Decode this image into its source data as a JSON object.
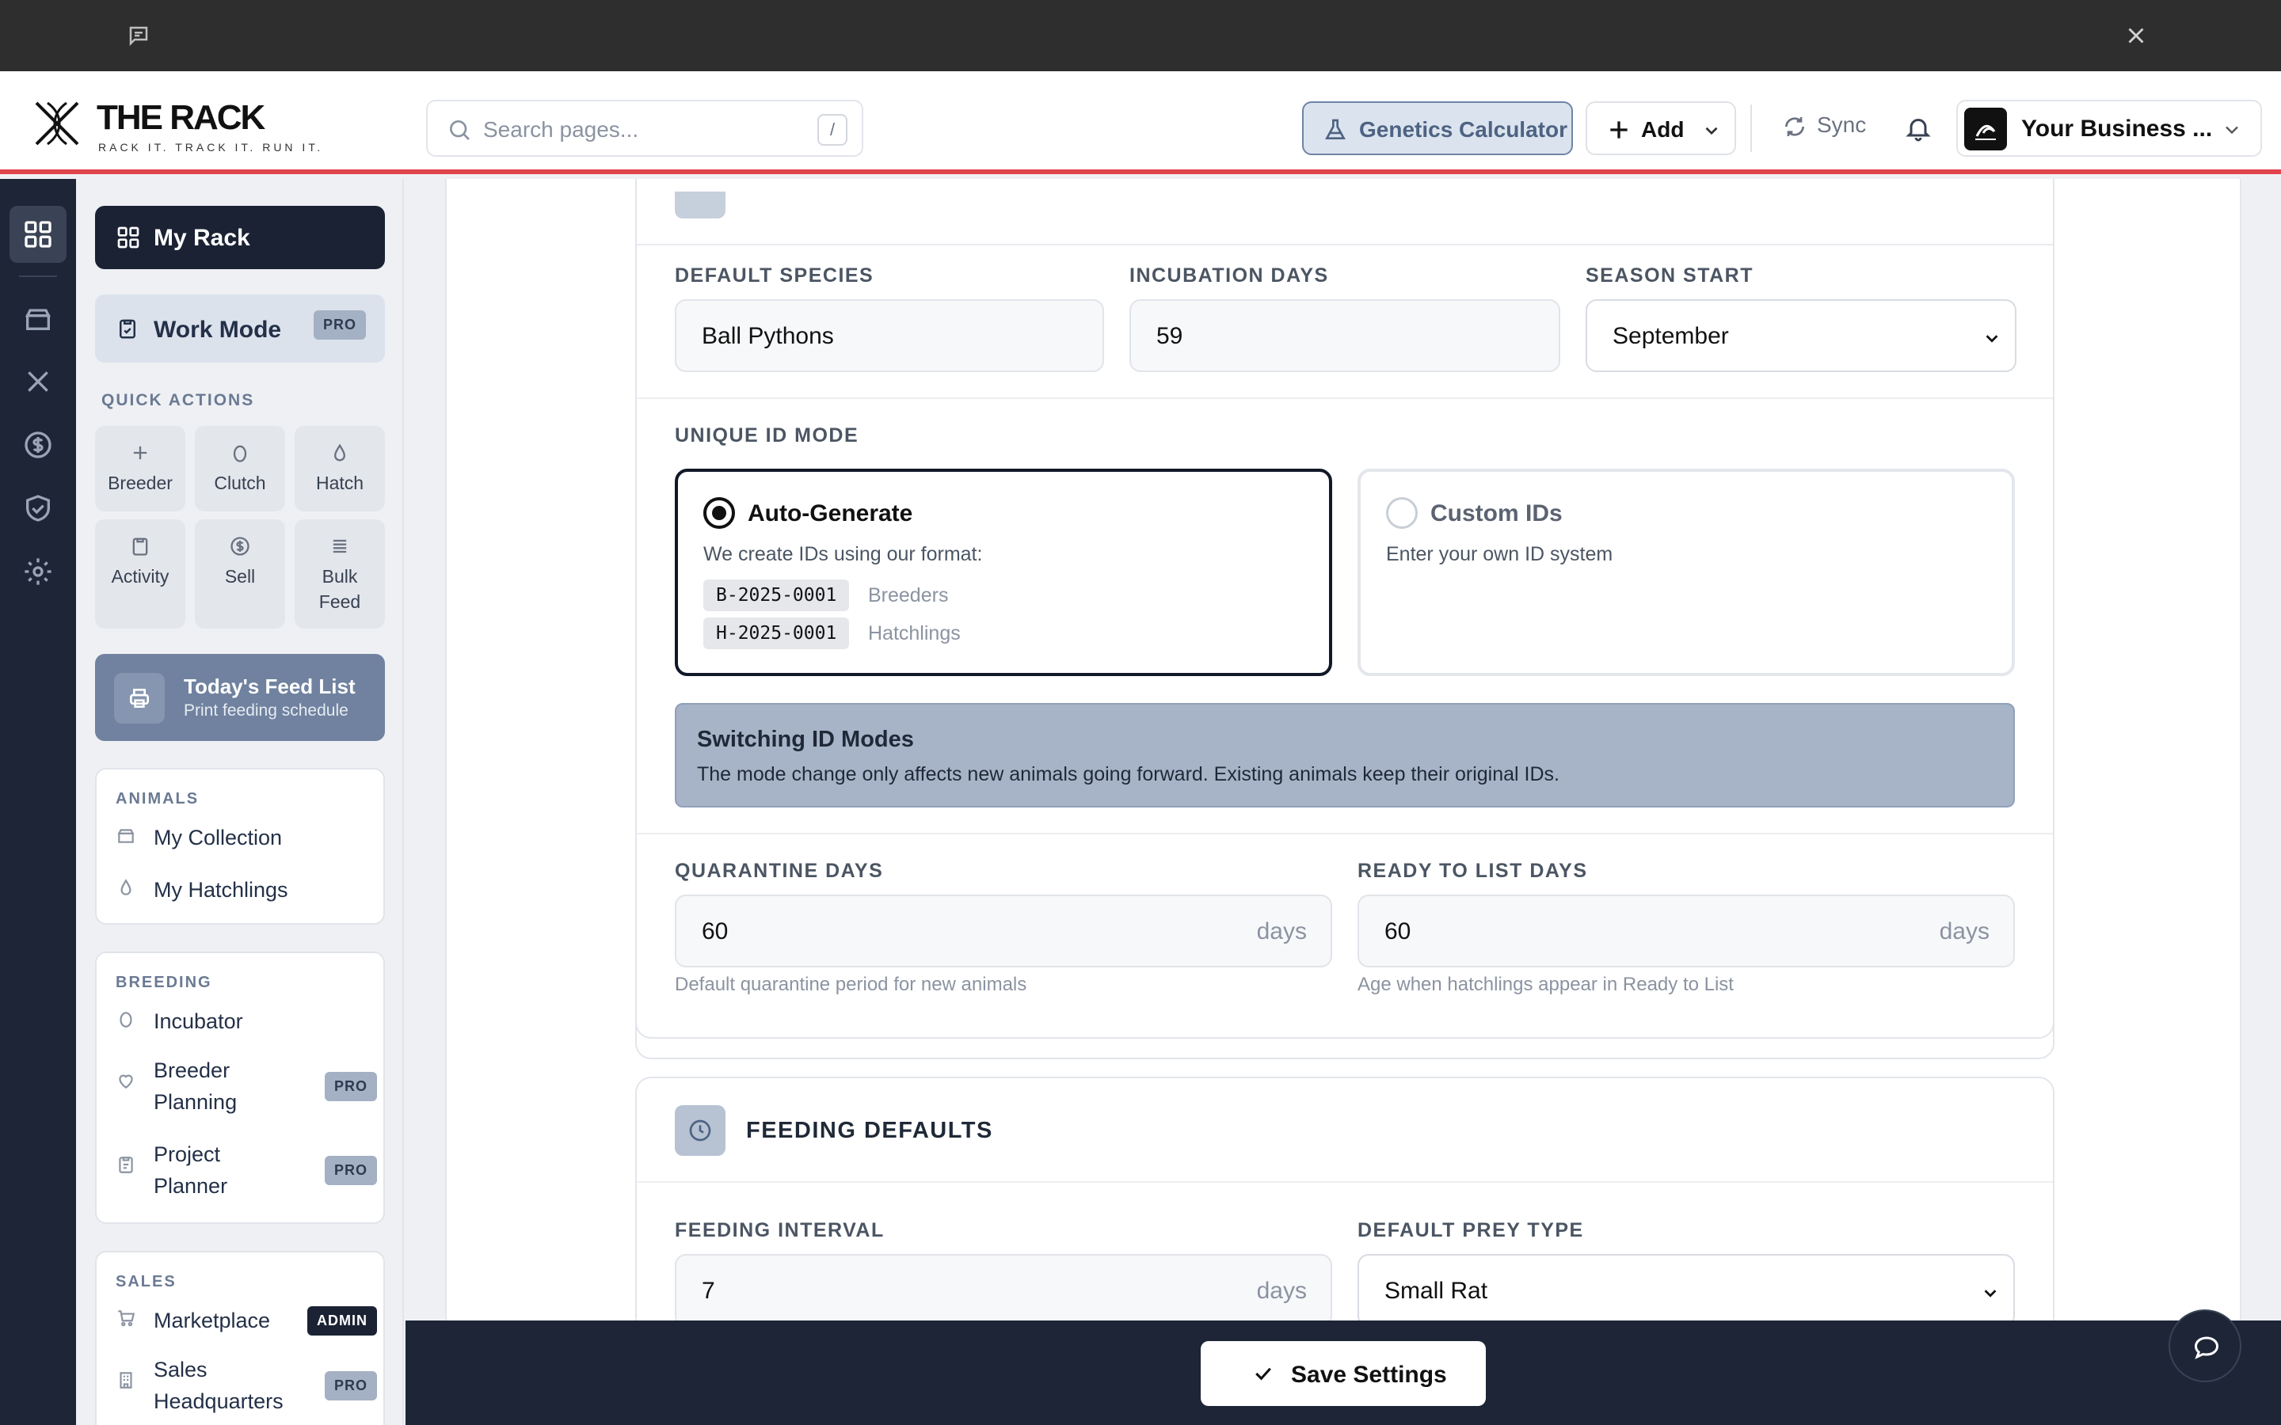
{
  "header": {
    "logo_title": "THE RACK",
    "logo_tagline": "RACK IT. TRACK IT. RUN IT.",
    "search_placeholder": "Search pages...",
    "search_shortcut": "/",
    "genetics_label": "Genetics Calculator",
    "add_label": "Add",
    "sync_label": "Sync",
    "business_label": "Your Business ..."
  },
  "sidebar": {
    "my_rack": "My Rack",
    "work_mode": "Work Mode",
    "pro_badge": "PRO",
    "admin_badge": "ADMIN",
    "quick_actions_title": "QUICK ACTIONS",
    "quick_actions": [
      {
        "label": "Breeder",
        "icon": "plus-icon"
      },
      {
        "label": "Clutch",
        "icon": "egg-icon"
      },
      {
        "label": "Hatch",
        "icon": "drop-icon"
      },
      {
        "label": "Activity",
        "icon": "clipboard-icon"
      },
      {
        "label": "Sell",
        "icon": "dollar-circle-icon"
      },
      {
        "label": "Bulk Feed",
        "icon": "lines-icon"
      }
    ],
    "feed_list_title": "Today's Feed List",
    "feed_list_sub": "Print feeding schedule",
    "animals_caption": "ANIMALS",
    "animals": [
      "My Collection",
      "My Hatchlings"
    ],
    "breeding_caption": "BREEDING",
    "breeding": [
      "Incubator",
      "Breeder Planning",
      "Project Planner"
    ],
    "sales_caption": "SALES",
    "sales": [
      "Marketplace",
      "Sales Headquarters"
    ]
  },
  "settings": {
    "default_species_label": "DEFAULT SPECIES",
    "default_species_value": "Ball Pythons",
    "incubation_days_label": "INCUBATION DAYS",
    "incubation_days_value": "59",
    "season_start_label": "SEASON START",
    "season_start_value": "September",
    "unique_id_label": "UNIQUE ID MODE",
    "auto_title": "Auto-Generate",
    "auto_desc": "We create IDs using our format:",
    "breeder_code": "B-2025-0001",
    "breeder_code_label": "Breeders",
    "hatchling_code": "H-2025-0001",
    "hatchling_code_label": "Hatchlings",
    "custom_title": "Custom IDs",
    "custom_desc": "Enter your own ID system",
    "note_title": "Switching ID Modes",
    "note_body": "The mode change only affects new animals going forward. Existing animals keep their original IDs.",
    "quarantine_label": "QUARANTINE DAYS",
    "quarantine_value": "60",
    "quarantine_help": "Default quarantine period for new animals",
    "ready_label": "READY TO LIST DAYS",
    "ready_value": "60",
    "ready_help": "Age when hatchlings appear in Ready to List",
    "days_unit": "days"
  },
  "feeding": {
    "title": "FEEDING DEFAULTS",
    "interval_label": "FEEDING INTERVAL",
    "interval_value": "7",
    "prey_label": "DEFAULT PREY TYPE",
    "prey_value": "Small Rat"
  },
  "footer": {
    "save_label": "Save Settings"
  },
  "colors": {
    "header_accent": "#e1444c",
    "rail_bg": "#1d2536",
    "primary_dark": "#1a2233",
    "note_bg": "#a7b4c8"
  }
}
